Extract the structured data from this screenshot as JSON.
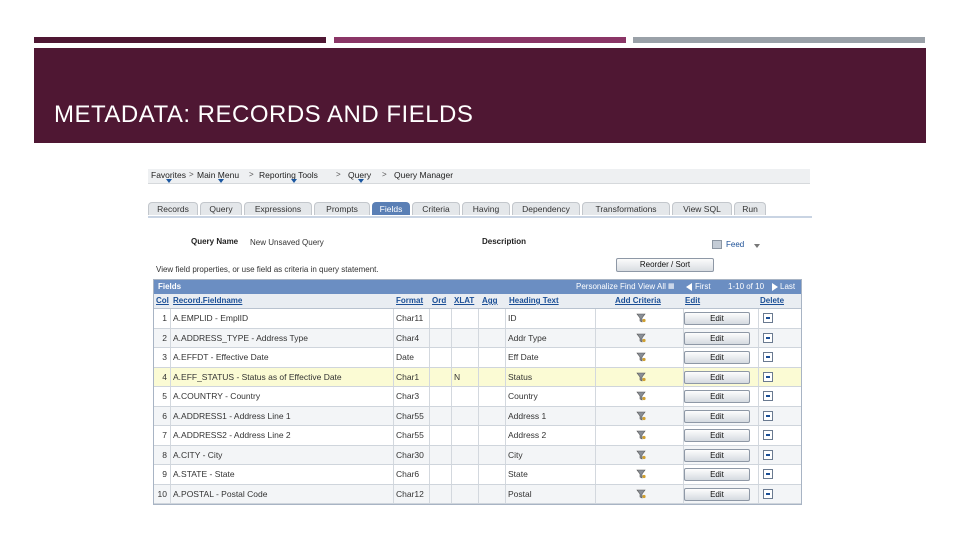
{
  "slide": {
    "title": "METADATA: RECORDS AND FIELDS"
  },
  "breadcrumbs": [
    "Favorites",
    "Main Menu",
    "Reporting Tools",
    "Query",
    "Query Manager"
  ],
  "tabs": [
    "Records",
    "Query",
    "Expressions",
    "Prompts",
    "Fields",
    "Criteria",
    "Having",
    "Dependency",
    "Transformations",
    "View SQL",
    "Run"
  ],
  "active_tab": "Fields",
  "query": {
    "name_label": "Query Name",
    "name_value": "New Unsaved Query",
    "description_label": "Description",
    "feed_label": "Feed",
    "hint": "View field properties, or use field as criteria in query statement.",
    "reorder_button": "Reorder / Sort"
  },
  "grid": {
    "caption": "Fields",
    "personalize": "Personalize",
    "find": "Find",
    "view_all": "View All",
    "first": "First",
    "range": "1-10 of 10",
    "last": "Last",
    "columns": [
      "Col",
      "Record.Fieldname",
      "Format",
      "Ord",
      "XLAT",
      "Agg",
      "Heading Text",
      "Add Criteria",
      "Edit",
      "Delete"
    ],
    "edit_label": "Edit",
    "rows": [
      {
        "col": "1",
        "field": "A.EMPLID - EmplID",
        "format": "Char11",
        "ord": "",
        "xlat": "",
        "agg": "",
        "heading": "ID"
      },
      {
        "col": "2",
        "field": "A.ADDRESS_TYPE - Address Type",
        "format": "Char4",
        "ord": "",
        "xlat": "",
        "agg": "",
        "heading": "Addr Type"
      },
      {
        "col": "3",
        "field": "A.EFFDT - Effective Date",
        "format": "Date",
        "ord": "",
        "xlat": "",
        "agg": "",
        "heading": "Eff Date"
      },
      {
        "col": "4",
        "field": "A.EFF_STATUS - Status as of Effective Date",
        "format": "Char1",
        "ord": "",
        "xlat": "N",
        "agg": "",
        "heading": "Status"
      },
      {
        "col": "5",
        "field": "A.COUNTRY - Country",
        "format": "Char3",
        "ord": "",
        "xlat": "",
        "agg": "",
        "heading": "Country"
      },
      {
        "col": "6",
        "field": "A.ADDRESS1 - Address Line 1",
        "format": "Char55",
        "ord": "",
        "xlat": "",
        "agg": "",
        "heading": "Address 1"
      },
      {
        "col": "7",
        "field": "A.ADDRESS2 - Address Line 2",
        "format": "Char55",
        "ord": "",
        "xlat": "",
        "agg": "",
        "heading": "Address 2"
      },
      {
        "col": "8",
        "field": "A.CITY - City",
        "format": "Char30",
        "ord": "",
        "xlat": "",
        "agg": "",
        "heading": "City"
      },
      {
        "col": "9",
        "field": "A.STATE - State",
        "format": "Char6",
        "ord": "",
        "xlat": "",
        "agg": "",
        "heading": "State"
      },
      {
        "col": "10",
        "field": "A.POSTAL - Postal Code",
        "format": "Char12",
        "ord": "",
        "xlat": "",
        "agg": "",
        "heading": "Postal"
      }
    ]
  },
  "colors": {
    "banner": "#4f1733",
    "accent_bar_2": "#8a3566",
    "accent_bar_3": "#9aa1a8",
    "grid_header": "#6b8ec2",
    "highlight_row": "#fbfbd4"
  },
  "icons": {
    "add_criteria": "funnel-icon",
    "delete": "minus-box-icon",
    "feed": "feed-icon",
    "nav_first": "arrow-left-icon",
    "nav_last": "arrow-right-icon"
  }
}
